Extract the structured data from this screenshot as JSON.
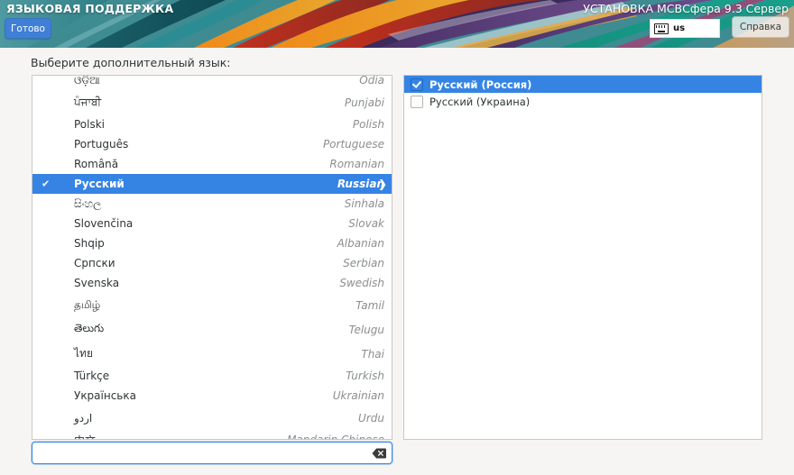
{
  "header": {
    "title_left": "ЯЗЫКОВАЯ ПОДДЕРЖКА",
    "title_right": "УСТАНОВКА МСВСфера 9.3 Сервер",
    "done_label": "Готово",
    "help_label": "Справка",
    "keyboard_layout": "us",
    "accent_color": "#3584e4",
    "done_button_color": "#3f7fd6"
  },
  "main": {
    "prompt": "Выберите дополнительный язык:",
    "languages": [
      {
        "native": "ଓଡ଼ିଆ",
        "english": "Odia",
        "selected": false,
        "tall": false
      },
      {
        "native": "ਪੰਜਾਬੀ",
        "english": "Punjabi",
        "selected": false,
        "tall": true
      },
      {
        "native": "Polski",
        "english": "Polish",
        "selected": false,
        "tall": false
      },
      {
        "native": "Português",
        "english": "Portuguese",
        "selected": false,
        "tall": false
      },
      {
        "native": "Română",
        "english": "Romanian",
        "selected": false,
        "tall": false
      },
      {
        "native": "Русский",
        "english": "Russian",
        "selected": true,
        "tall": false
      },
      {
        "native": "සිංහල",
        "english": "Sinhala",
        "selected": false,
        "tall": false
      },
      {
        "native": "Slovenčina",
        "english": "Slovak",
        "selected": false,
        "tall": false
      },
      {
        "native": "Shqip",
        "english": "Albanian",
        "selected": false,
        "tall": false
      },
      {
        "native": "Српски",
        "english": "Serbian",
        "selected": false,
        "tall": false
      },
      {
        "native": "Svenska",
        "english": "Swedish",
        "selected": false,
        "tall": false
      },
      {
        "native": "தமிழ்",
        "english": "Tamil",
        "selected": false,
        "tall": true
      },
      {
        "native": "తెలుగు",
        "english": "Telugu",
        "selected": false,
        "tall": true
      },
      {
        "native": "ไทย",
        "english": "Thai",
        "selected": false,
        "tall": true
      },
      {
        "native": "Türkçe",
        "english": "Turkish",
        "selected": false,
        "tall": false
      },
      {
        "native": "Українська",
        "english": "Ukrainian",
        "selected": false,
        "tall": false
      },
      {
        "native": "اردو",
        "english": "Urdu",
        "selected": false,
        "tall": true
      },
      {
        "native": "中文",
        "english": "Mandarin Chinese",
        "selected": false,
        "tall": false
      }
    ],
    "search": {
      "value": "",
      "placeholder": "",
      "clear_icon": "backspace-clear-icon"
    },
    "locales": [
      {
        "label": "Русский (Россия)",
        "checked": true,
        "selected": true
      },
      {
        "label": "Русский (Украина)",
        "checked": false,
        "selected": false
      }
    ]
  }
}
